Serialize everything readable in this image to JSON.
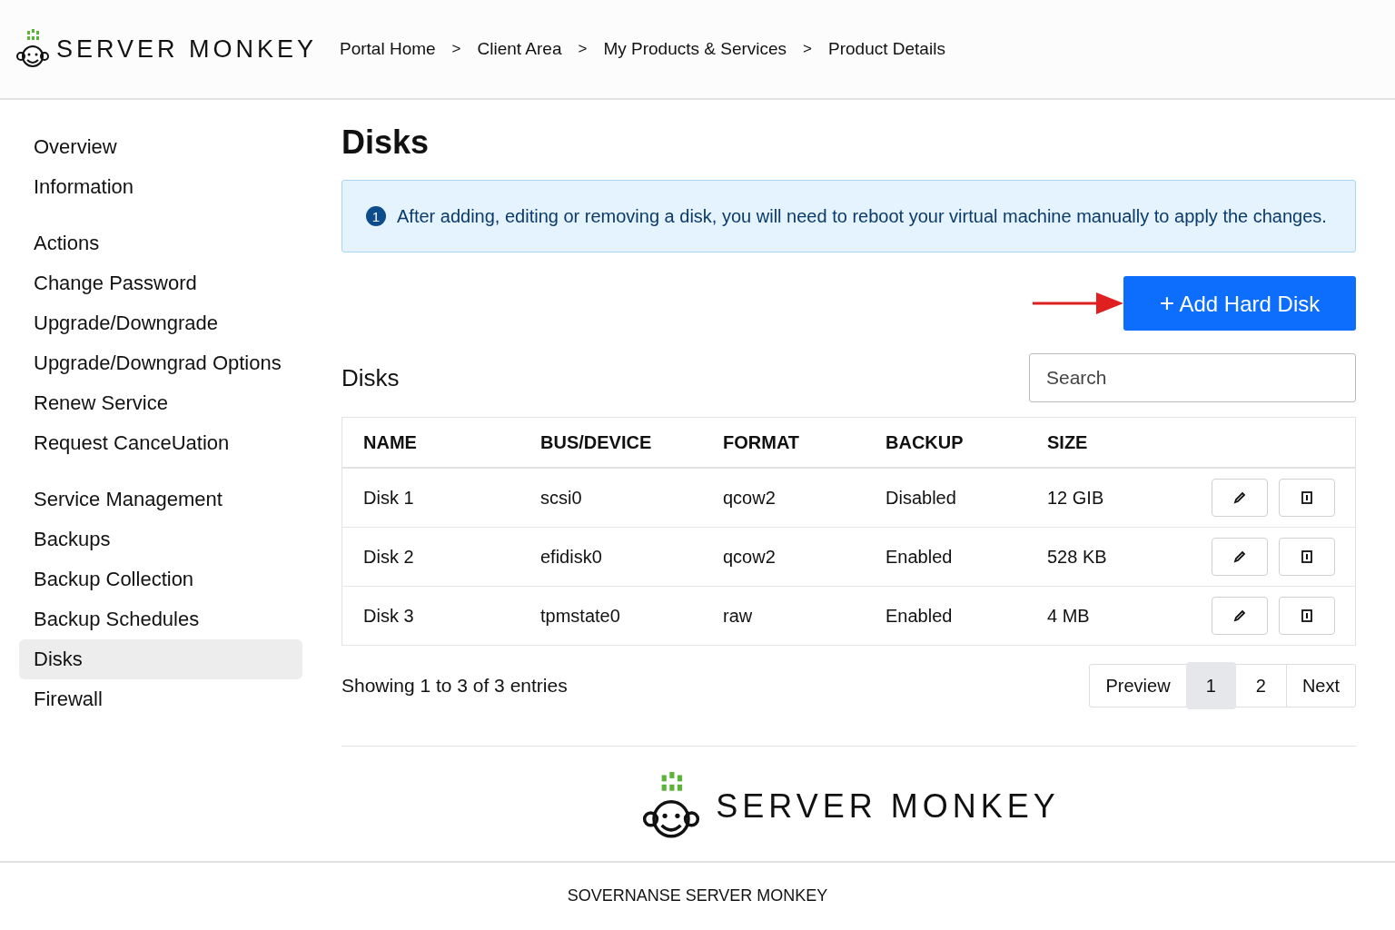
{
  "header": {
    "logo_text": "SERVER MONKEY",
    "breadcrumbs": [
      "Portal Home",
      "Client Area",
      "My Products & Services",
      "Product Details"
    ],
    "separator": ">"
  },
  "sidebar": {
    "groups": [
      {
        "title": "Overview",
        "items": [
          {
            "label": "Information",
            "selected": false
          }
        ]
      },
      {
        "title": "Actions",
        "items": [
          {
            "label": "Change Password",
            "selected": false
          },
          {
            "label": "Upgrade/Downgrade",
            "selected": false
          },
          {
            "label": "Upgrade/Downgrad Options",
            "selected": false
          },
          {
            "label": "Renew Service",
            "selected": false
          },
          {
            "label": "Request CanceUation",
            "selected": false
          }
        ]
      },
      {
        "title": "Service Management",
        "items": [
          {
            "label": "Backups",
            "selected": false
          },
          {
            "label": "Backup Collection",
            "selected": false
          },
          {
            "label": "Backup Schedules",
            "selected": false
          },
          {
            "label": "Disks",
            "selected": true
          },
          {
            "label": "Firewall",
            "selected": false
          }
        ]
      }
    ]
  },
  "page_title": "Disks",
  "alert": {
    "icon_text": "1",
    "message": "After adding, editing or removing a disk, you will need to reboot your virtual machine manually to apply the changes."
  },
  "add_button": {
    "icon_text": "+",
    "label": "Add Hard Disk"
  },
  "table_title": "Disks",
  "search": {
    "placeholder": "Search"
  },
  "table": {
    "columns": [
      "NAME",
      "BUS/DEVICE",
      "FORMAT",
      "BACKUP",
      "SIZE"
    ],
    "rows": [
      [
        "Disk 1",
        "scsi0",
        "qcow2",
        "Disabled",
        "12 GIB"
      ],
      [
        "Disk 2",
        "efidisk0",
        "qcow2",
        "Enabled",
        "528 KB"
      ],
      [
        "Disk 3",
        "tpmstate0",
        "raw",
        "Enabled",
        "4 MB"
      ]
    ]
  },
  "entries_info": "Showing 1 to 3 of 3 entries",
  "pagination": [
    {
      "label": "Preview",
      "kind": "nav",
      "selected": false
    },
    {
      "label": "1",
      "kind": "page",
      "selected": true
    },
    {
      "label": "2",
      "kind": "page",
      "selected": false
    },
    {
      "label": "Next",
      "kind": "nav",
      "selected": false
    }
  ],
  "footer_logo_text": "SERVER MONKEY",
  "footer_text": "SOVERNANSE SERVER MONKEY"
}
